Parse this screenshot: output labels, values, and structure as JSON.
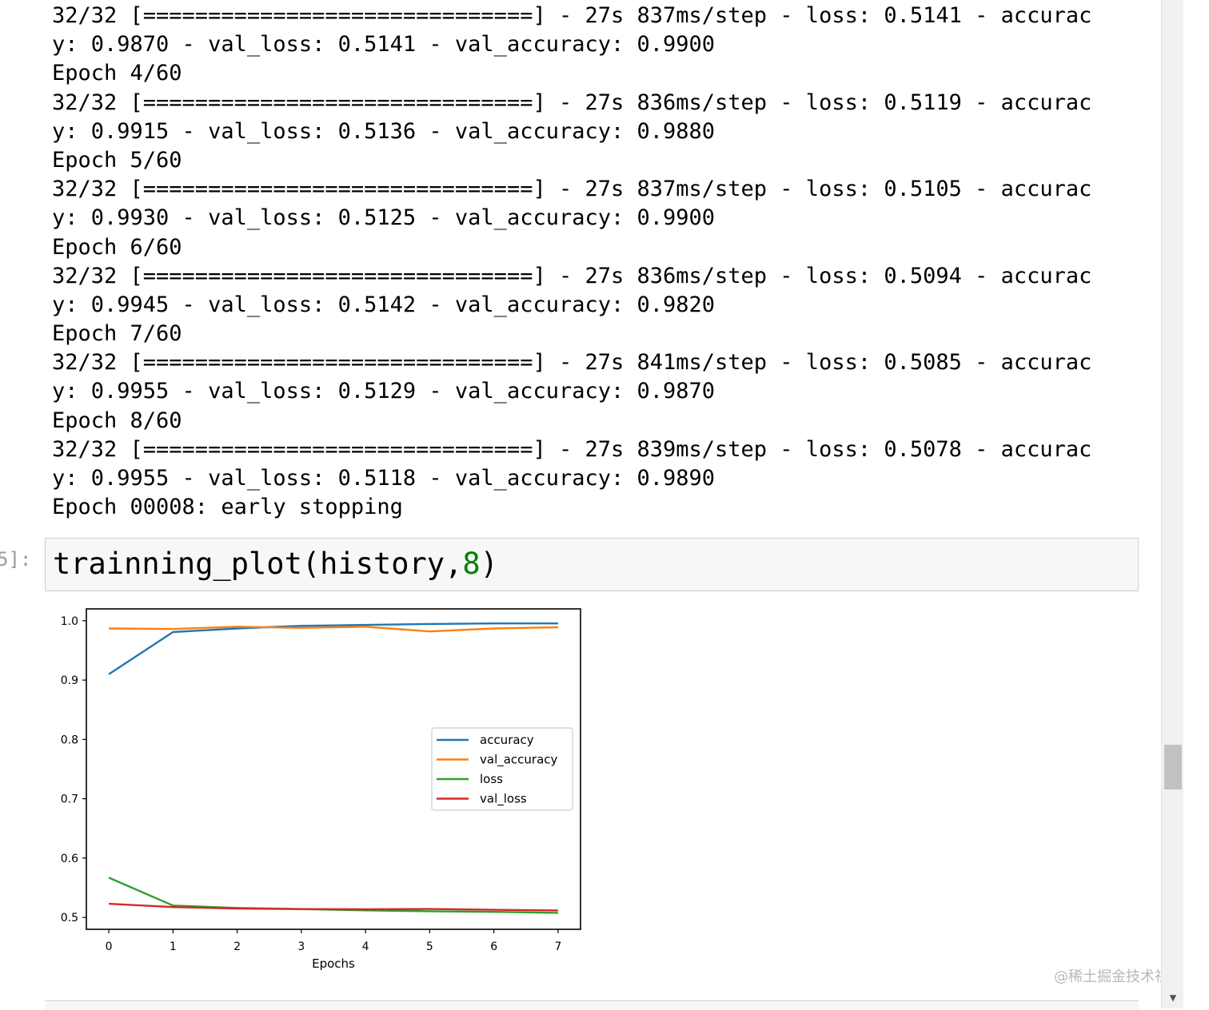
{
  "log": {
    "lines": [
      "32/32 [==============================] - 27s 837ms/step - loss: 0.5141 - accurac",
      "y: 0.9870 - val_loss: 0.5141 - val_accuracy: 0.9900",
      "Epoch 4/60",
      "32/32 [==============================] - 27s 836ms/step - loss: 0.5119 - accurac",
      "y: 0.9915 - val_loss: 0.5136 - val_accuracy: 0.9880",
      "Epoch 5/60",
      "32/32 [==============================] - 27s 837ms/step - loss: 0.5105 - accurac",
      "y: 0.9930 - val_loss: 0.5125 - val_accuracy: 0.9900",
      "Epoch 6/60",
      "32/32 [==============================] - 27s 836ms/step - loss: 0.5094 - accurac",
      "y: 0.9945 - val_loss: 0.5142 - val_accuracy: 0.9820",
      "Epoch 7/60",
      "32/32 [==============================] - 27s 841ms/step - loss: 0.5085 - accurac",
      "y: 0.9955 - val_loss: 0.5129 - val_accuracy: 0.9870",
      "Epoch 8/60",
      "32/32 [==============================] - 27s 839ms/step - loss: 0.5078 - accurac",
      "y: 0.9955 - val_loss: 0.5118 - val_accuracy: 0.9890",
      "Epoch 00008: early stopping"
    ]
  },
  "cell": {
    "prompt": "5]:",
    "code_prefix": "trainning_plot(history,",
    "code_number": "8",
    "code_suffix": ")"
  },
  "watermark": "@稀土掘金技术社区",
  "chart_data": {
    "type": "line",
    "xlabel": "Epochs",
    "ylabel": "",
    "x": [
      0,
      1,
      2,
      3,
      4,
      5,
      6,
      7
    ],
    "xlim": [
      -0.35,
      7.35
    ],
    "ylim": [
      0.48,
      1.02
    ],
    "xticks": [
      0,
      1,
      2,
      3,
      4,
      5,
      6,
      7
    ],
    "yticks": [
      0.5,
      0.6,
      0.7,
      0.8,
      0.9,
      1.0
    ],
    "ytick_labels": [
      "0.5",
      "0.6",
      "0.7",
      "0.8",
      "0.9",
      "1.0"
    ],
    "grid": false,
    "legend_position": "center-right",
    "series": [
      {
        "name": "accuracy",
        "color": "#1f77b4",
        "values": [
          0.91,
          0.981,
          0.987,
          0.9915,
          0.993,
          0.9945,
          0.9955,
          0.9955
        ]
      },
      {
        "name": "val_accuracy",
        "color": "#ff7f0e",
        "values": [
          0.987,
          0.986,
          0.99,
          0.988,
          0.99,
          0.982,
          0.987,
          0.989
        ]
      },
      {
        "name": "loss",
        "color": "#2ca02c",
        "values": [
          0.567,
          0.52,
          0.516,
          0.5141,
          0.5119,
          0.5105,
          0.5094,
          0.5078
        ]
      },
      {
        "name": "val_loss",
        "color": "#d62728",
        "values": [
          0.523,
          0.5175,
          0.515,
          0.5141,
          0.5136,
          0.5142,
          0.5129,
          0.5118
        ]
      }
    ]
  }
}
